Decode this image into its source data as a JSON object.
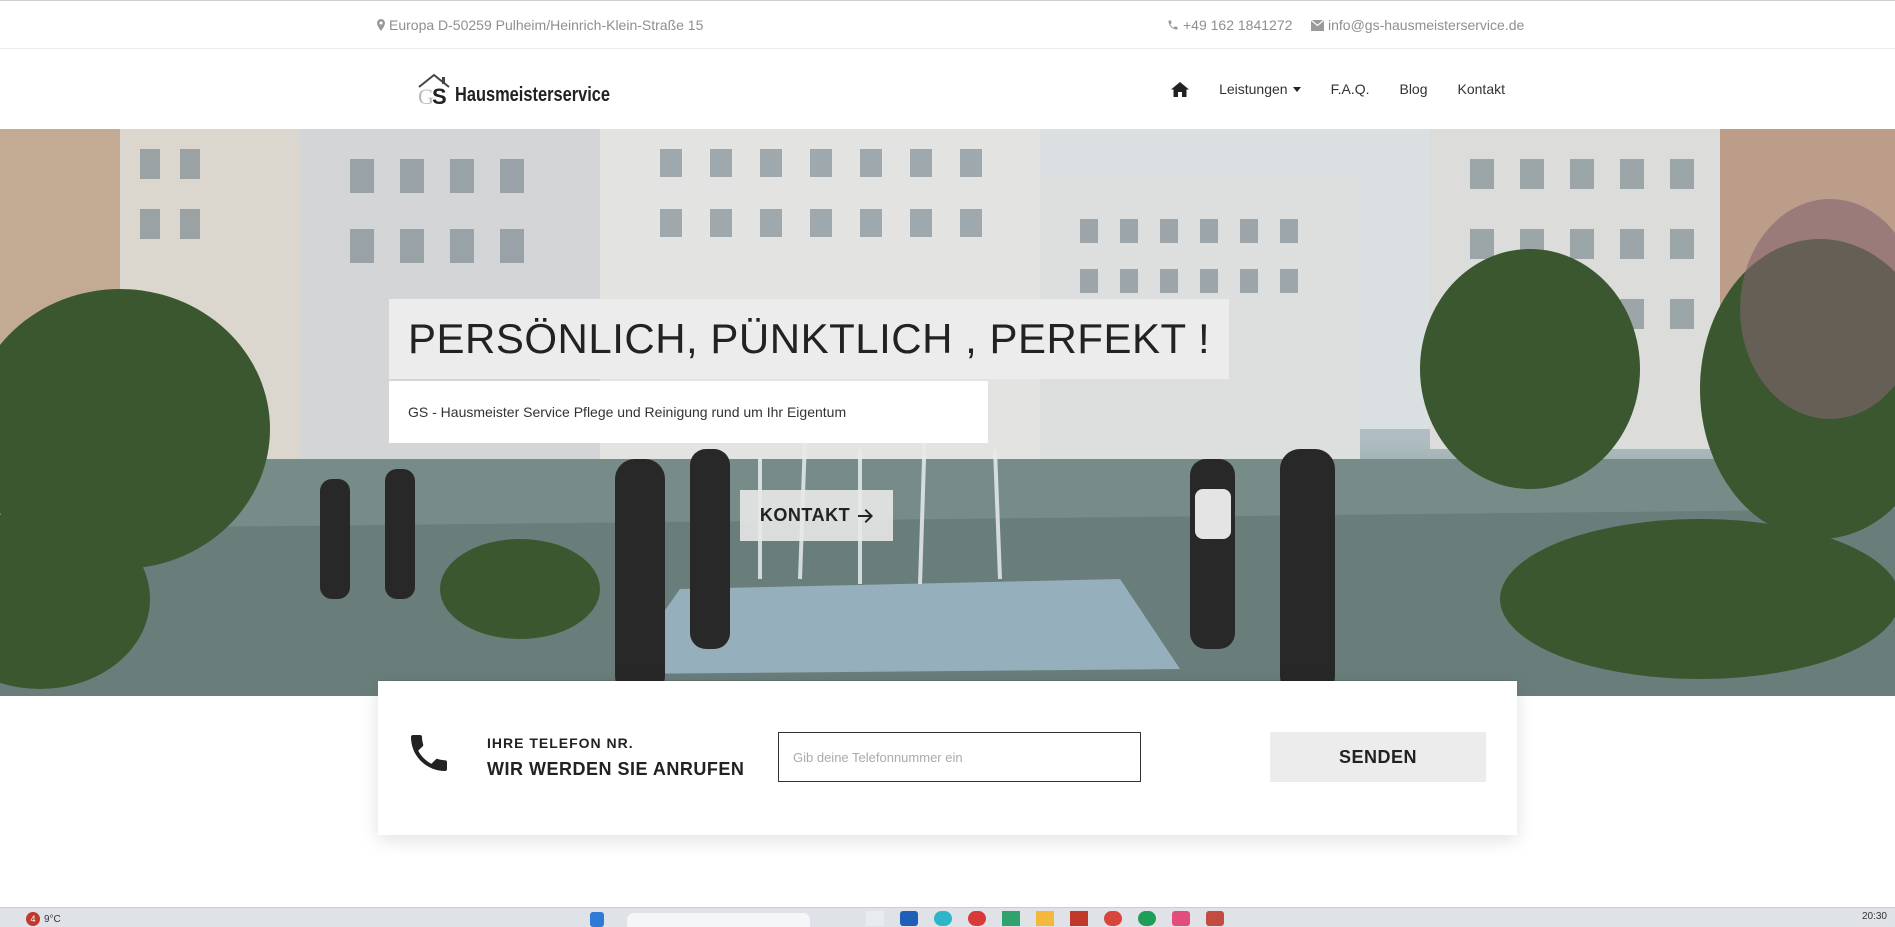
{
  "topbar": {
    "address": "Europa D-50259 Pulheim/Heinrich-Klein-Straße 15",
    "phone": "+49 162 1841272",
    "email": "info@gs-hausmeisterservice.de"
  },
  "logo": {
    "mark": "GS",
    "text": "Hausmeisterservice"
  },
  "nav": {
    "home_icon": "home-icon",
    "items": [
      {
        "label": "Leistungen",
        "dropdown": true
      },
      {
        "label": "F.A.Q."
      },
      {
        "label": "Blog"
      },
      {
        "label": "Kontakt"
      }
    ]
  },
  "hero": {
    "headline": "PERSÖNLICH, PÜNKTLICH , PERFEKT !",
    "subtitle": "GS - Hausmeister Service Pflege und Reinigung rund um Ihr Eigentum",
    "button_label": "KONTAKT"
  },
  "callback": {
    "label_small": "IHRE TELEFON NR.",
    "label_big": "WIR WERDEN SIE ANRUFEN",
    "input_placeholder": "Gib deine Telefonnummer ein",
    "send_label": "SENDEN"
  },
  "taskbar": {
    "badge": "4",
    "temperature": "9°C",
    "clock": "20:30"
  },
  "colors": {
    "text": "#333333",
    "muted": "#8f8f8f",
    "panel": "#ececec"
  }
}
